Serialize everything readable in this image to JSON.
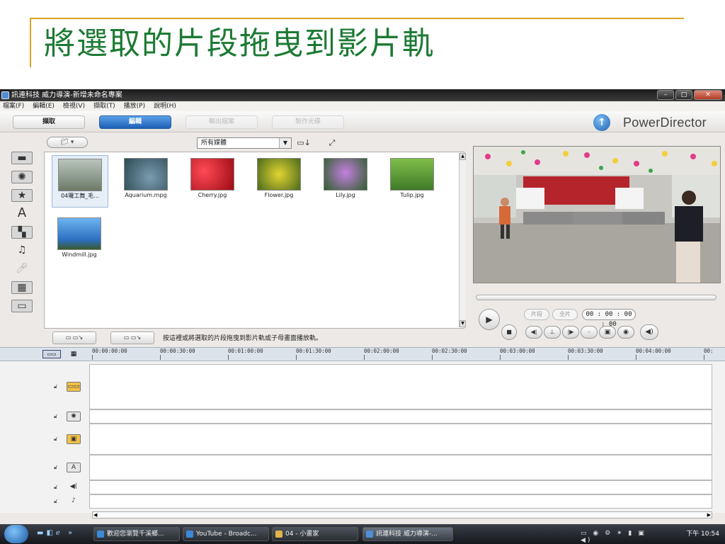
{
  "slide": {
    "title": "將選取的片段拖曳到影片軌"
  },
  "window": {
    "title": "訊連科技 威力導演-新增未命名專案",
    "menu": [
      "檔案(F)",
      "編輯(E)",
      "檢視(V)",
      "擷取(T)",
      "播放(P)",
      "說明(H)"
    ],
    "modes": [
      "擷取",
      "編輯",
      "輸出檔案",
      "製作光碟"
    ],
    "brand": "PowerDirector"
  },
  "library": {
    "filter": "所有媒體",
    "items": [
      {
        "name": "04囉工舞_毛...",
        "color": "#9aa89a"
      },
      {
        "name": "Aquarium.mpg",
        "color": "#4b6a6e"
      },
      {
        "name": "Cherry.jpg",
        "color": "#c1121e"
      },
      {
        "name": "Flower.jpg",
        "color": "#7a8f2a"
      },
      {
        "name": "Lily.jpg",
        "color": "#3d6e3a"
      },
      {
        "name": "Tulip.jpg",
        "color": "#5f9a3a"
      },
      {
        "name": "Windmill.jpg",
        "color": "#3b7fc8"
      }
    ],
    "hint": "按這裡或將選取的片段拖曳到影片軌或子母畫面播放軌。"
  },
  "player": {
    "clip_label": "片段",
    "movie_label": "全片",
    "timecode": "00 : 00 : 00 : 00"
  },
  "timeline": {
    "ticks": [
      "00:00:00:00",
      "00:00:30:00",
      "00:01:00:00",
      "00:01:30:00",
      "00:02:00:00",
      "00:02:30:00",
      "00:03:00:00",
      "00:03:30:00",
      "00:04:00:00",
      "00:"
    ]
  },
  "taskbar": {
    "items": [
      "歡迎您瀏覽千溪鄉...",
      "YouTube - Broadc...",
      "04 - 小畫家",
      "訊連科技 威力導演-..."
    ],
    "clock": "下午 10:54"
  },
  "colors": {
    "title_green": "#1c7a33",
    "accent_gold": "#d9a520",
    "edit_blue": "#1c5fb5"
  }
}
